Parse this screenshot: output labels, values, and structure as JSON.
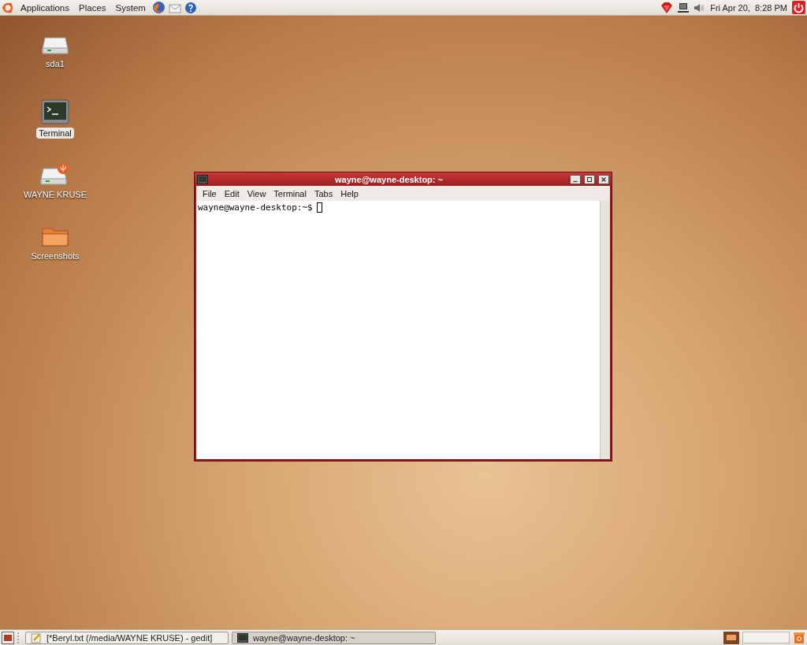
{
  "top_panel": {
    "menus": [
      {
        "label": "Applications"
      },
      {
        "label": "Places"
      },
      {
        "label": "System"
      }
    ],
    "clock": "Fri Apr 20,  8:28 PM"
  },
  "desktop_icons": [
    {
      "kind": "drive",
      "label": "sda1",
      "selected": false
    },
    {
      "kind": "terminal",
      "label": "Terminal",
      "selected": true
    },
    {
      "kind": "usb",
      "label": "WAYNE KRUSE",
      "selected": false
    },
    {
      "kind": "folder",
      "label": "Screenshots",
      "selected": false
    }
  ],
  "window": {
    "title": "wayne@wayne-desktop: ~",
    "menu": [
      {
        "label": "File"
      },
      {
        "label": "Edit"
      },
      {
        "label": "View"
      },
      {
        "label": "Terminal"
      },
      {
        "label": "Tabs"
      },
      {
        "label": "Help"
      }
    ],
    "prompt": "wayne@wayne-desktop:~$"
  },
  "taskbar": [
    {
      "kind": "editor",
      "label": "[*Beryl.txt (/media/WAYNE KRUSE) - gedit]",
      "selected": false
    },
    {
      "kind": "terminal",
      "label": "wayne@wayne-desktop: ~",
      "selected": true
    }
  ]
}
